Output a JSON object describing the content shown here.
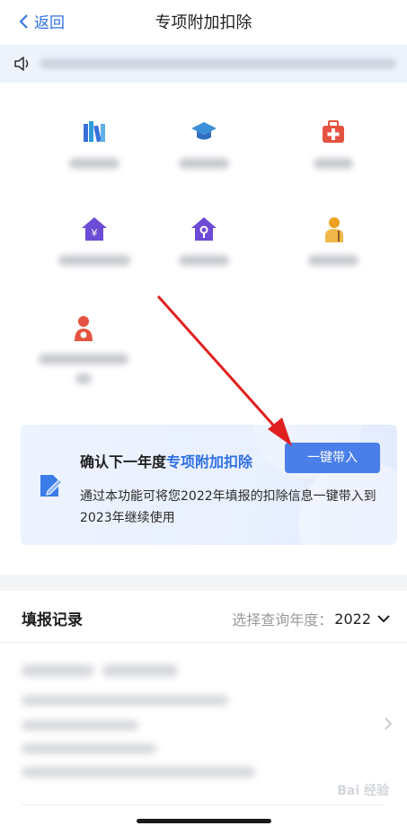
{
  "nav": {
    "back_label": "返回",
    "title": "专项附加扣除"
  },
  "notice": {
    "icon": "speaker-icon"
  },
  "categories": [
    {
      "icon": "books-icon",
      "color": "#3b6fd8"
    },
    {
      "icon": "graduation-cap-icon",
      "color": "#3b8fd8"
    },
    {
      "icon": "medical-kit-icon",
      "color": "#e4533f"
    },
    {
      "icon": "house-yuan-icon",
      "color": "#6c4bd6"
    },
    {
      "icon": "house-key-icon",
      "color": "#6c4bd6"
    },
    {
      "icon": "elderly-person-icon",
      "color": "#f0a020"
    },
    {
      "icon": "mother-child-icon",
      "color": "#e4533f"
    }
  ],
  "banner": {
    "heading_prefix": "确认下一年度",
    "heading_highlight": "专项附加扣除",
    "button_label": "一键带入",
    "description": "通过本功能可将您2022年填报的扣除信息一键带入到2023年继续使用"
  },
  "records": {
    "title": "填报记录",
    "year_prompt": "选择查询年度：",
    "year_value": "2022"
  },
  "watermark": "Bai 经验",
  "colors": {
    "accent": "#2f6fe4",
    "button": "#4a7ee8",
    "arrow": "#e02020"
  }
}
